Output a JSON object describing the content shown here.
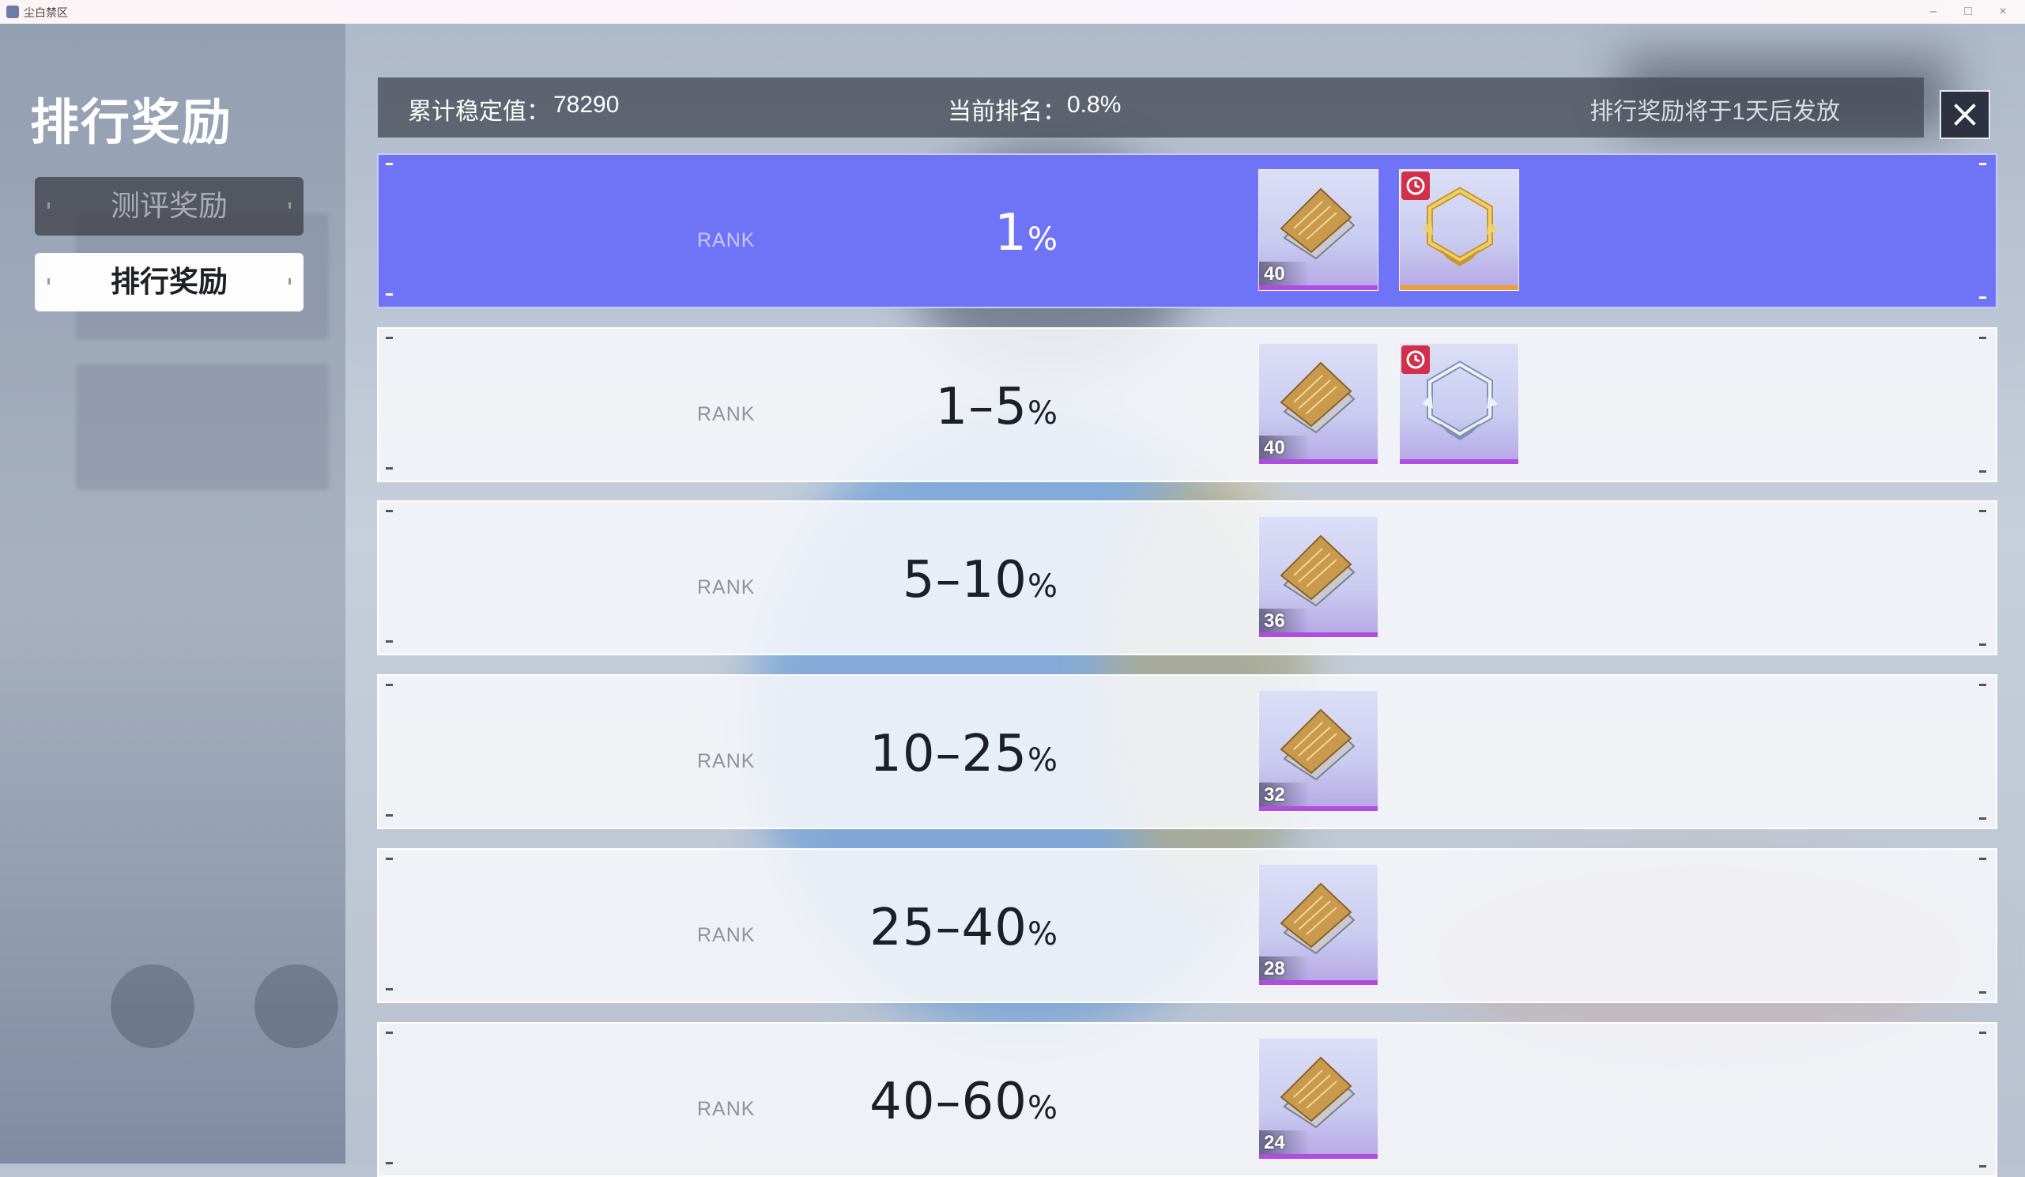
{
  "window": {
    "title": "尘白禁区",
    "controls": {
      "minimize": "–",
      "maximize": "□",
      "close": "×"
    }
  },
  "sidebar": {
    "title": "排行奖励",
    "tabs": [
      {
        "label": "测评奖励",
        "selected": false
      },
      {
        "label": "排行奖励",
        "selected": true
      }
    ]
  },
  "header": {
    "stability_label": "累计稳定值：",
    "stability_value": "78290",
    "rank_label": "当前排名：",
    "rank_value": "0.8%",
    "notice": "排行奖励将于1天后发放",
    "close_icon": "close-icon"
  },
  "rank_word": "RANK",
  "tiers": [
    {
      "range": "1",
      "pct": "%",
      "highlight": true,
      "rewards": [
        {
          "icon": "card-pack-icon",
          "count": "40"
        },
        {
          "icon": "gold-frame-icon",
          "count": "",
          "timed": true,
          "rarity_color": "#f0a030"
        }
      ]
    },
    {
      "range": "1–5",
      "pct": "%",
      "highlight": false,
      "rewards": [
        {
          "icon": "card-pack-icon",
          "count": "40"
        },
        {
          "icon": "silver-frame-icon",
          "count": "",
          "timed": true,
          "rarity_color": "#b14ce0"
        }
      ]
    },
    {
      "range": "5–10",
      "pct": "%",
      "highlight": false,
      "rewards": [
        {
          "icon": "card-pack-icon",
          "count": "36"
        }
      ]
    },
    {
      "range": "10–25",
      "pct": "%",
      "highlight": false,
      "rewards": [
        {
          "icon": "card-pack-icon",
          "count": "32"
        }
      ]
    },
    {
      "range": "25–40",
      "pct": "%",
      "highlight": false,
      "rewards": [
        {
          "icon": "card-pack-icon",
          "count": "28"
        }
      ]
    },
    {
      "range": "40–60",
      "pct": "%",
      "highlight": false,
      "rewards": [
        {
          "icon": "card-pack-icon",
          "count": "24"
        }
      ]
    }
  ],
  "colors": {
    "highlight_row": "#6f74f7",
    "rarity_purple": "#b14ce0",
    "rarity_gold": "#f0a030",
    "timer_badge": "#d0304a"
  }
}
